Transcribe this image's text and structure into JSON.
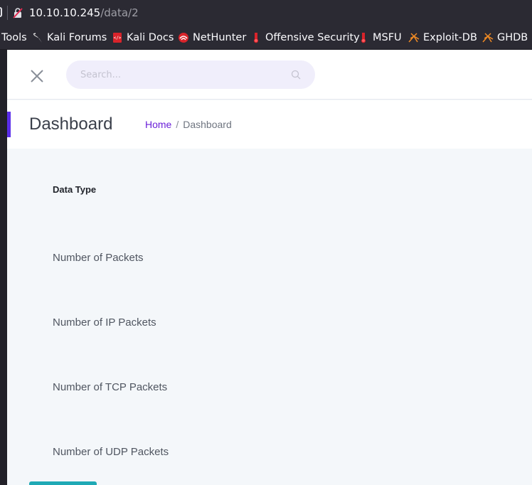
{
  "browser": {
    "url_host": "10.10.10.245",
    "url_path": "/data/2"
  },
  "bookmarks": [
    {
      "label": "Tools",
      "icon": "none"
    },
    {
      "label": "Kali Forums",
      "icon": "kali-dragon-icon"
    },
    {
      "label": "Kali Docs",
      "icon": "kali-docs-icon"
    },
    {
      "label": "NetHunter",
      "icon": "nethunter-icon"
    },
    {
      "label": "Offensive Security",
      "icon": "offsec-icon"
    },
    {
      "label": "MSFU",
      "icon": "msfu-icon"
    },
    {
      "label": "Exploit-DB",
      "icon": "exploitdb-icon"
    },
    {
      "label": "GHDB",
      "icon": "ghdb-icon"
    }
  ],
  "topbar": {
    "search_placeholder": "Search..."
  },
  "page": {
    "title": "Dashboard",
    "breadcrumb_home": "Home",
    "breadcrumb_separator": "/",
    "breadcrumb_current": "Dashboard"
  },
  "table": {
    "header": "Data Type",
    "rows": [
      "Number of Packets",
      "Number of IP Packets",
      "Number of TCP Packets",
      "Number of UDP Packets"
    ]
  },
  "colors": {
    "accent": "#5a2dea",
    "link": "#6a1fd8",
    "button": "#1fa9b5"
  }
}
